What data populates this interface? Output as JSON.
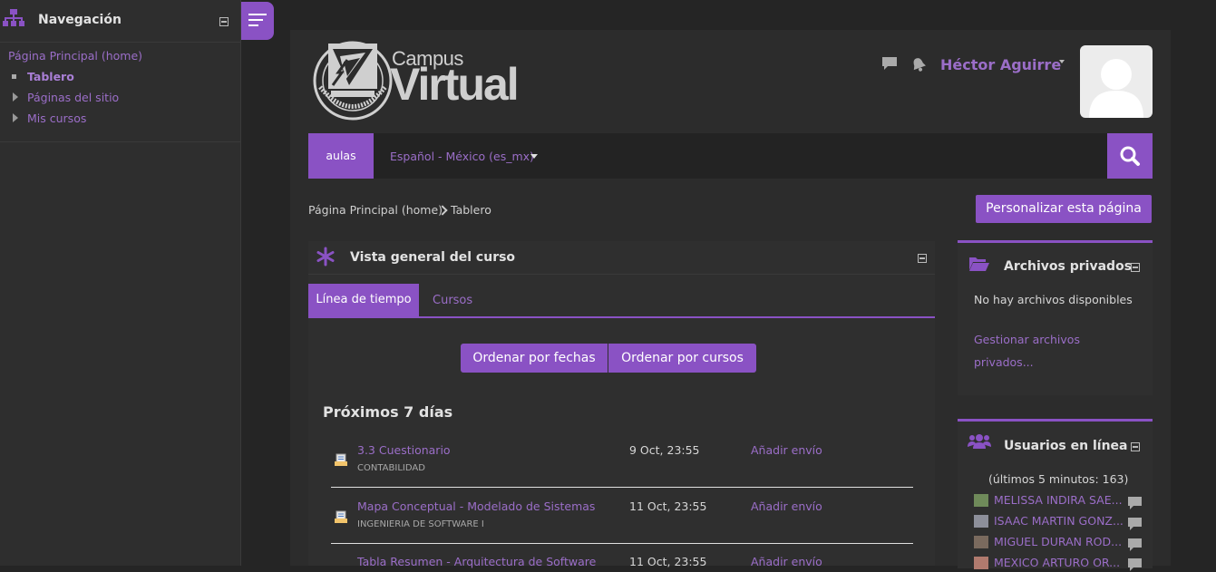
{
  "nav": {
    "title": "Navegación",
    "home": "Página Principal (home)",
    "items": [
      "Tablero",
      "Páginas del sitio",
      "Mis cursos"
    ]
  },
  "header": {
    "logo_line1": "Campus",
    "logo_line2": "Virtual",
    "user_name": "Héctor Aguirre"
  },
  "navbar": {
    "aulas": "aulas",
    "language": "Español - México (es_mx)"
  },
  "breadcrumb": {
    "home": "Página Principal (home)",
    "current": "Tablero"
  },
  "customize_button": "Personalizar esta página",
  "overview": {
    "title": "Vista general del curso",
    "tabs": [
      "Línea de tiempo",
      "Cursos"
    ],
    "sort_dates": "Ordenar por fechas",
    "sort_courses": "Ordenar por cursos",
    "section": "Próximos 7 días",
    "events": [
      {
        "title": "3.3 Cuestionario",
        "course": "CONTABILIDAD",
        "date": "9 Oct, 23:55",
        "action": "Añadir envío"
      },
      {
        "title": "Mapa Conceptual - Modelado de Sistemas",
        "course": "INGENIERIA DE SOFTWARE I",
        "date": "11 Oct, 23:55",
        "action": "Añadir envío"
      },
      {
        "title": "Tabla Resumen - Arquitectura de Software",
        "course": "",
        "date": "11 Oct, 23:55",
        "action": "Añadir envío"
      }
    ]
  },
  "private_files": {
    "title": "Archivos privados",
    "empty": "No hay archivos disponibles",
    "manage": "Gestionar archivos privados..."
  },
  "online_users": {
    "title": "Usuarios en línea",
    "subtitle": "(últimos 5 minutos: 163)",
    "users": [
      "MELISSA INDIRA SAE...",
      "ISAAC MARTIN GONZ...",
      "MIGUEL DURAN ROD...",
      "MEXICO ARTURO OR..."
    ]
  },
  "colors": {
    "accent": "#8a52c4",
    "link": "#9b6ec8",
    "background": "#252525",
    "panel": "#2c2c2c"
  }
}
